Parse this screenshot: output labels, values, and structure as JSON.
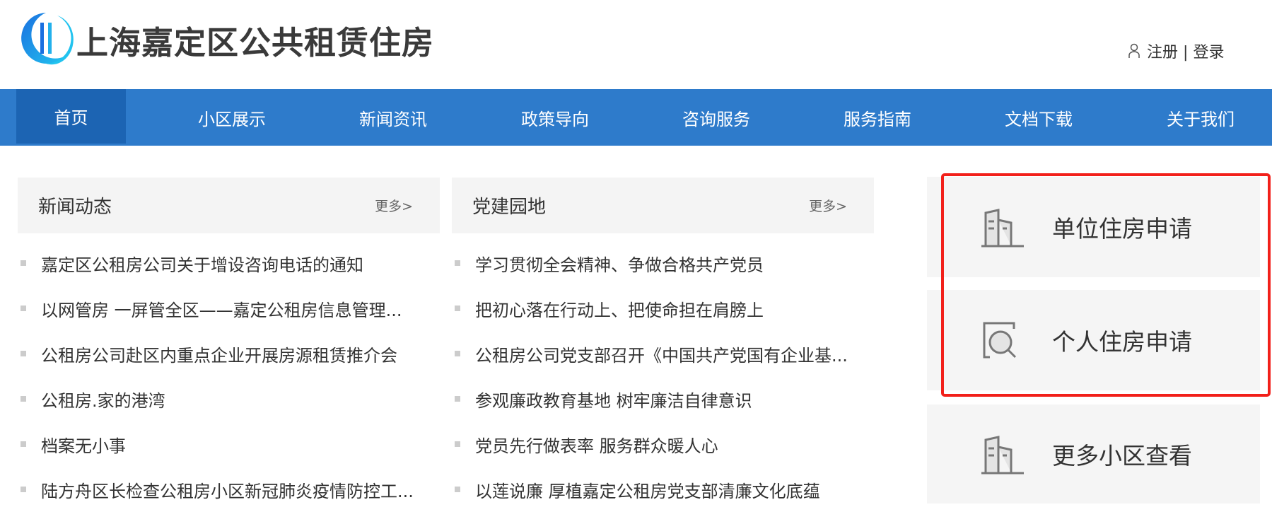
{
  "header": {
    "title": "上海嘉定区公共租赁住房",
    "register": "注册",
    "separator": "|",
    "login": "登录"
  },
  "nav": [
    {
      "label": "首页",
      "active": true
    },
    {
      "label": "小区展示"
    },
    {
      "label": "新闻资讯"
    },
    {
      "label": "政策导向"
    },
    {
      "label": "咨询服务"
    },
    {
      "label": "服务指南"
    },
    {
      "label": "文档下载"
    },
    {
      "label": "关于我们"
    }
  ],
  "news": {
    "title": "新闻动态",
    "more": "更多>",
    "items": [
      "嘉定区公租房公司关于增设咨询电话的通知",
      "以网管房 一屏管全区——嘉定公租房信息管理...",
      "公租房公司赴区内重点企业开展房源租赁推介会",
      "公租房.家的港湾",
      "档案无小事",
      "陆方舟区长检查公租房小区新冠肺炎疫情防控工..."
    ]
  },
  "party": {
    "title": "党建园地",
    "more": "更多>",
    "items": [
      "学习贯彻全会精神、争做合格共产党员",
      "把初心落在行动上、把使命担在肩膀上",
      "公租房公司党支部召开《中国共产党国有企业基...",
      "参观廉政教育基地 树牢廉洁自律意识",
      "党员先行做表率 服务群众暖人心",
      "以莲说廉 厚植嘉定公租房党支部清廉文化底蕴"
    ]
  },
  "cards": [
    {
      "label": "单位住房申请",
      "icon": "building-icon"
    },
    {
      "label": "个人住房申请",
      "icon": "search-doc-icon"
    },
    {
      "label": "更多小区查看",
      "icon": "building-icon"
    }
  ],
  "colors": {
    "nav": "#2e7bcb",
    "nav_active": "#1c64b3",
    "highlight": "#f2201a"
  }
}
